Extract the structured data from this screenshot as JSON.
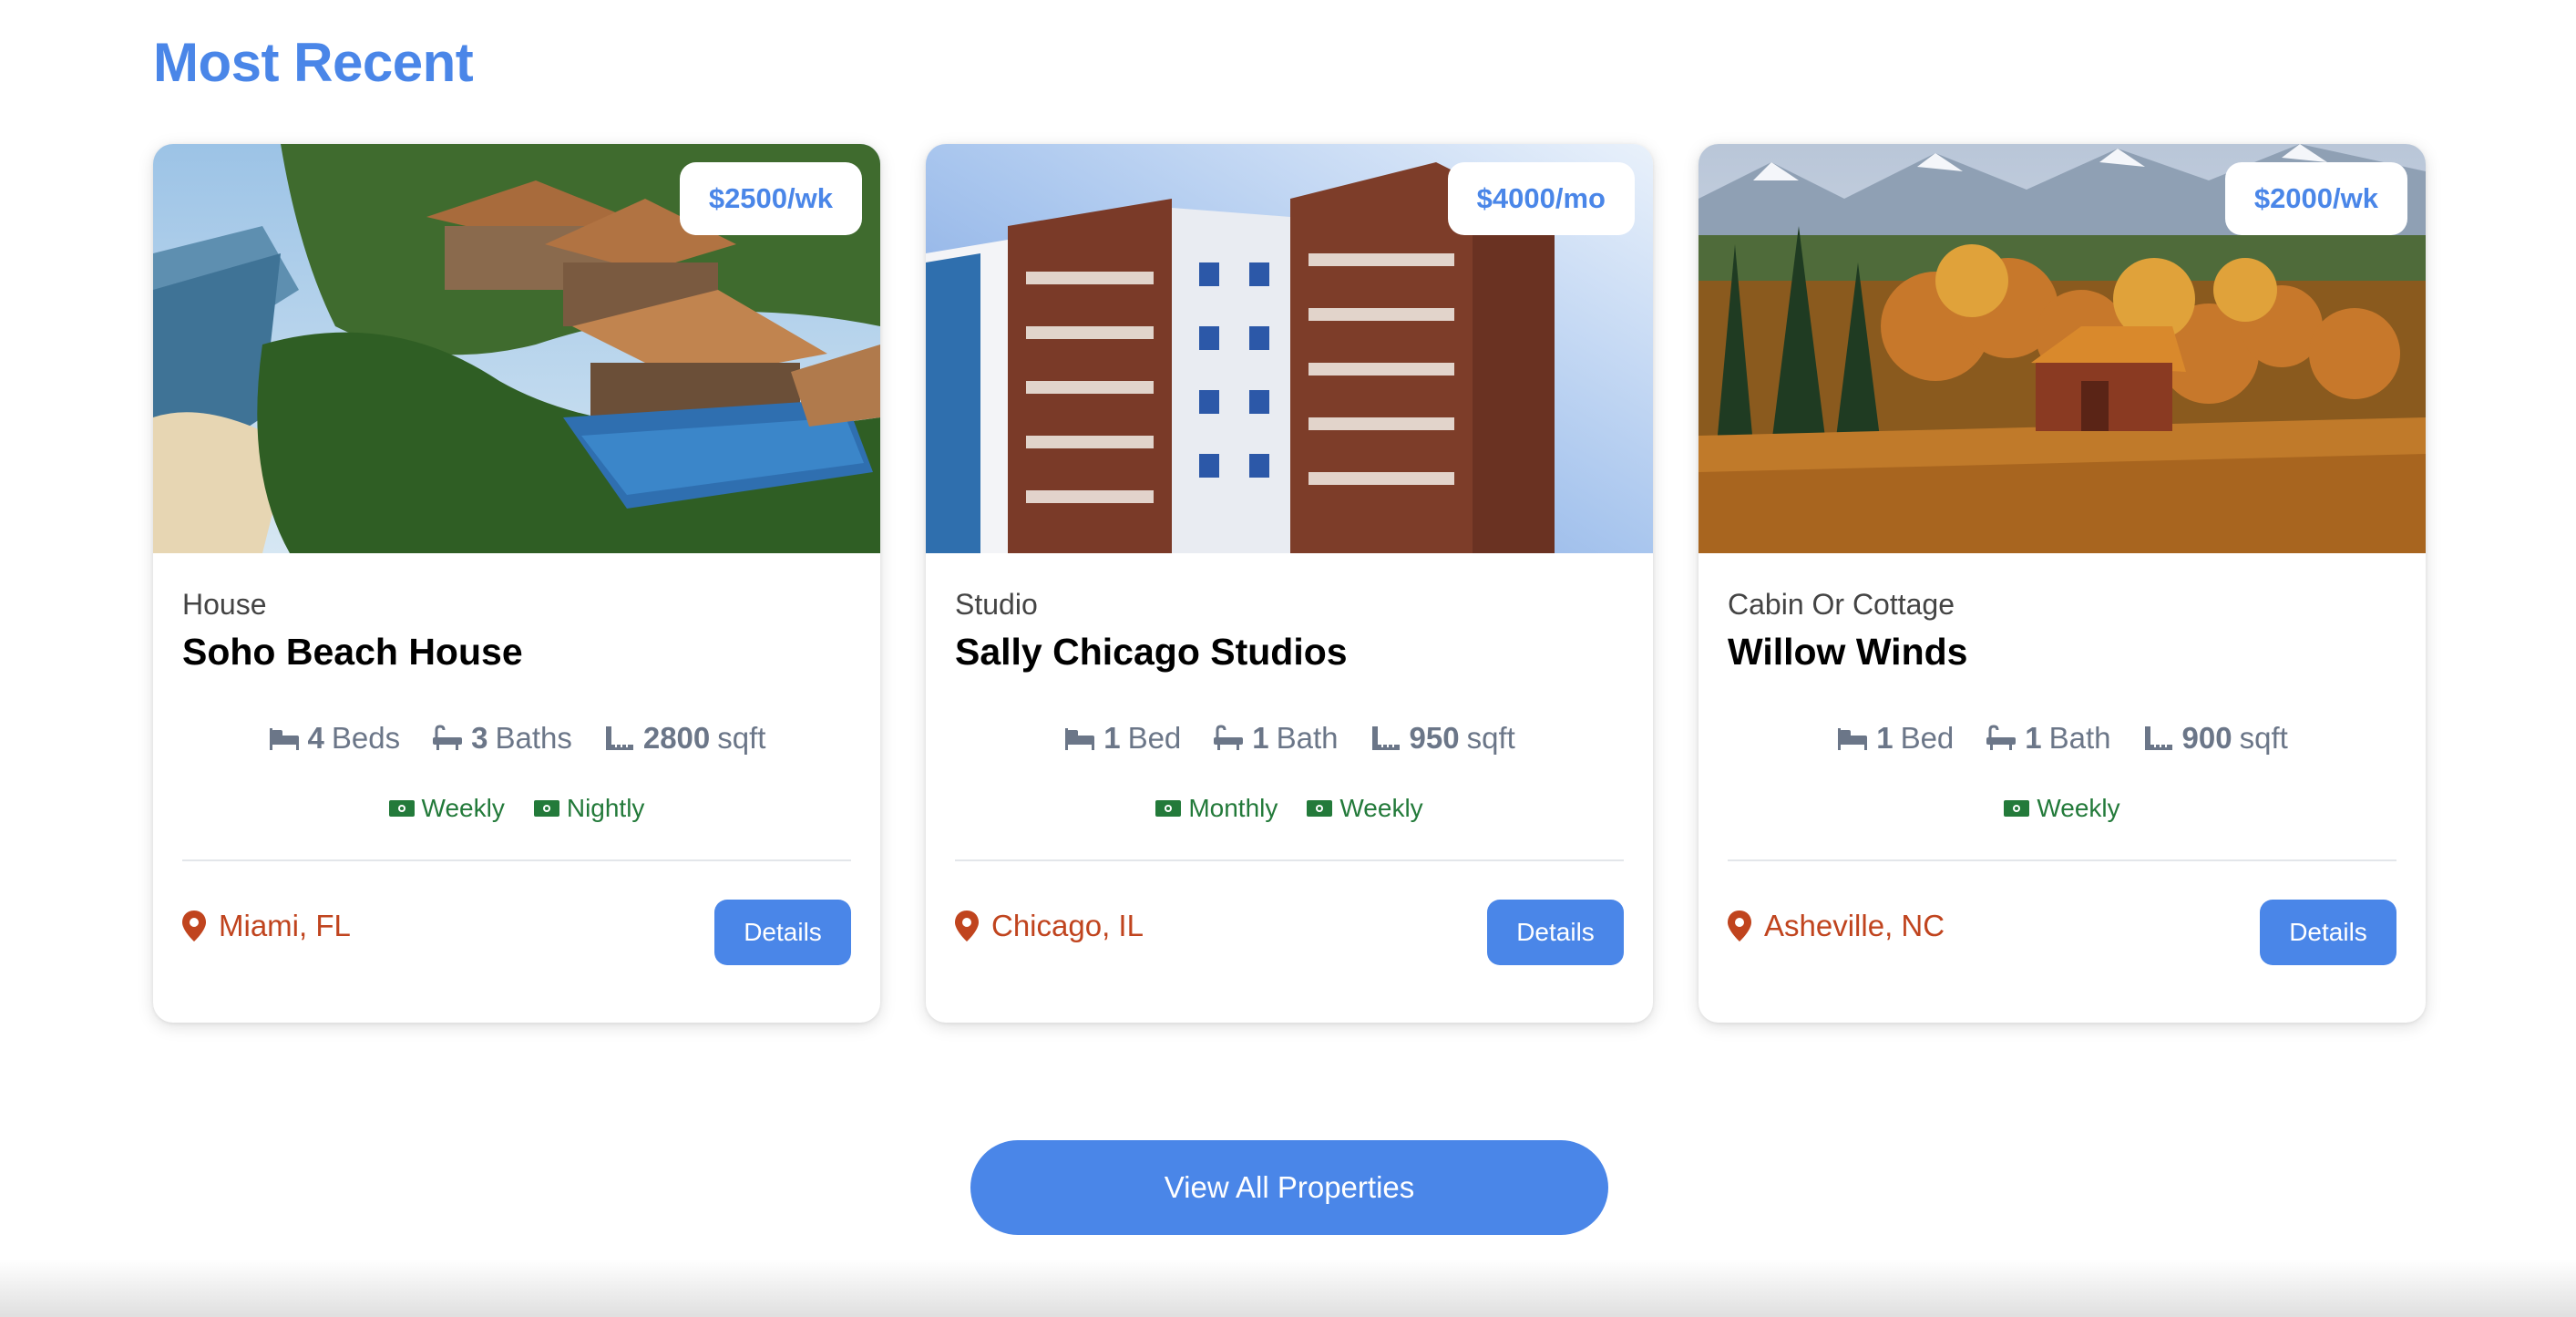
{
  "section": {
    "title": "Most Recent"
  },
  "properties": [
    {
      "price": "$2500/wk",
      "type": "House",
      "name": "Soho Beach House",
      "beds_value": "4",
      "beds_label": "Beds",
      "baths_value": "3",
      "baths_label": "Baths",
      "sqft_value": "2800",
      "sqft_label": "sqft",
      "rates": [
        "Weekly",
        "Nightly"
      ],
      "location": "Miami, FL",
      "details_label": "Details"
    },
    {
      "price": "$4000/mo",
      "type": "Studio",
      "name": "Sally Chicago Studios",
      "beds_value": "1",
      "beds_label": "Bed",
      "baths_value": "1",
      "baths_label": "Bath",
      "sqft_value": "950",
      "sqft_label": "sqft",
      "rates": [
        "Monthly",
        "Weekly"
      ],
      "location": "Chicago, IL",
      "details_label": "Details"
    },
    {
      "price": "$2000/wk",
      "type": "Cabin Or Cottage",
      "name": "Willow Winds",
      "beds_value": "1",
      "beds_label": "Bed",
      "baths_value": "1",
      "baths_label": "Bath",
      "sqft_value": "900",
      "sqft_label": "sqft",
      "rates": [
        "Weekly"
      ],
      "location": "Asheville, NC",
      "details_label": "Details"
    }
  ],
  "view_all": {
    "label": "View All Properties"
  },
  "icons": {
    "beds": "bed-icon",
    "baths": "bath-icon",
    "sqft": "ruler-icon",
    "rate": "money-bill-icon",
    "location": "map-pin-icon"
  },
  "colors": {
    "accent": "#4a86e8",
    "rate_green": "#237a3a",
    "location_orange": "#c0441e",
    "spec_gray": "#6b7688"
  }
}
